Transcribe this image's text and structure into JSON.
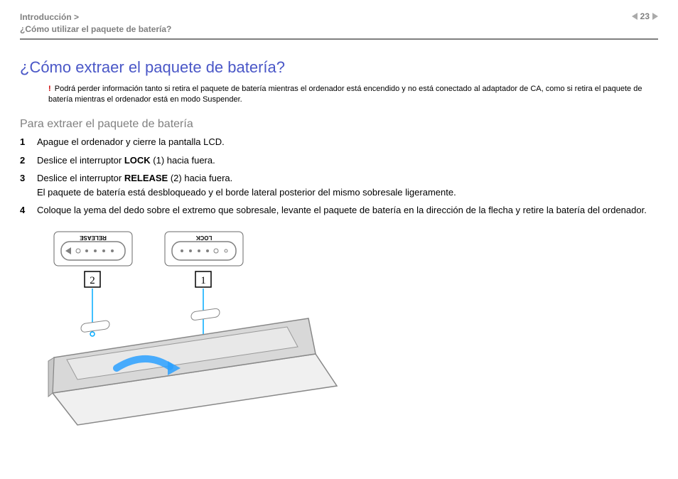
{
  "header": {
    "breadcrumb_section": "Introducción >",
    "breadcrumb_title": "¿Cómo utilizar el paquete de batería?",
    "page_number": "23"
  },
  "title": "¿Cómo extraer el paquete de batería?",
  "warning": {
    "icon": "!",
    "text": "Podrá perder información tanto si retira el paquete de batería mientras el ordenador está encendido y no está conectado al adaptador de CA, como si retira el paquete de batería mientras el ordenador está en modo Suspender."
  },
  "subheading": "Para extraer el paquete de batería",
  "steps": [
    {
      "n": "1",
      "text_parts": [
        "Apague el ordenador y cierre la pantalla LCD."
      ]
    },
    {
      "n": "2",
      "text_parts": [
        "Deslice el interruptor ",
        "LOCK",
        " (1) hacia fuera."
      ]
    },
    {
      "n": "3",
      "text_parts": [
        "Deslice el interruptor ",
        "RELEASE",
        " (2) hacia fuera.\nEl paquete de batería está desbloqueado y el borde lateral posterior del mismo sobresale ligeramente."
      ]
    },
    {
      "n": "4",
      "text_parts": [
        "Coloque la yema del dedo sobre el extremo que sobresale, levante el paquete de batería en la dirección de la flecha y retire la batería del ordenador."
      ]
    }
  ],
  "callouts": {
    "label_release": "RELEASE",
    "label_lock": "LOCK",
    "marker_2": "2",
    "marker_1": "1"
  }
}
